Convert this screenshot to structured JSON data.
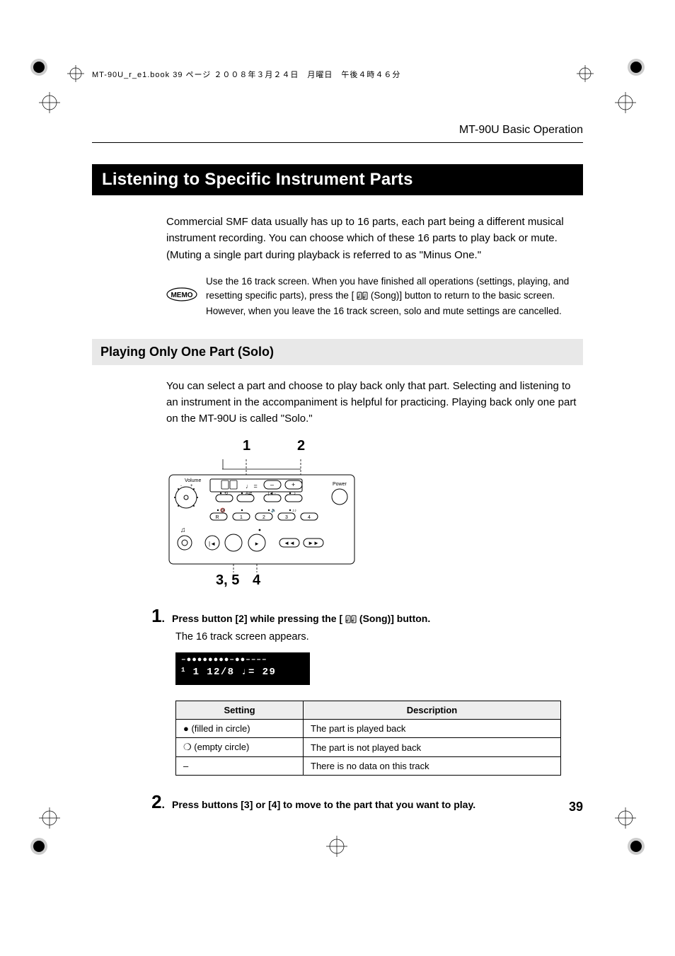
{
  "print_header": "MT-90U_r_e1.book  39 ページ  ２００８年３月２４日　月曜日　午後４時４６分",
  "section_header_right": "MT-90U Basic Operation",
  "section_title": "Listening to Specific Instrument Parts",
  "intro_para": "Commercial SMF data usually has up to 16 parts, each part being a different musical instrument recording. You can choose which of these 16 parts to play back or mute. (Muting a single part during playback is referred to as \"Minus One.\"",
  "memo_label": "MEMO",
  "memo_text_a": "Use the 16 track screen. When you have finished all operations (settings, playing, and resetting specific parts), press the [ ",
  "memo_text_b": " (Song)] button to return to the basic screen. However, when you leave the 16 track screen, solo and mute settings are cancelled.",
  "subhead": "Playing Only One Part (Solo)",
  "solo_para": "You can select a part and choose to play back only that part. Selecting and listening to an instrument in the accompaniment is helpful for practicing. Playing back only one part on the MT-90U is called \"Solo.\"",
  "callouts": {
    "c1": "1",
    "c2": "2",
    "c3": "3, 5",
    "c4": "4"
  },
  "panel_labels": {
    "volume": "Volume",
    "power": "Power",
    "r": "R",
    "b1": "1",
    "b2": "2",
    "b3": "3",
    "b4": "4"
  },
  "step1": {
    "num": "1",
    "text_a": "Press button [2] while pressing the [ ",
    "text_b": " (Song)] button."
  },
  "step1_sub": "The 16 track screen appears.",
  "lcd": {
    "row1": "–●●●●●●●●–●●––––",
    "row2_a": "1",
    "row2_b": "1   12/8   ♩= 29"
  },
  "table": {
    "headers": {
      "setting": "Setting",
      "description": "Description"
    },
    "rows": [
      {
        "setting": "● (filled in circle)",
        "desc": "The part is played back"
      },
      {
        "setting": "❍ (empty circle)",
        "desc": "The part is not played back"
      },
      {
        "setting": "–",
        "desc": "There is no data on this track"
      }
    ]
  },
  "step2": {
    "num": "2",
    "text": "Press buttons [3] or [4] to move to the part that you want to play."
  },
  "page_number": "39"
}
